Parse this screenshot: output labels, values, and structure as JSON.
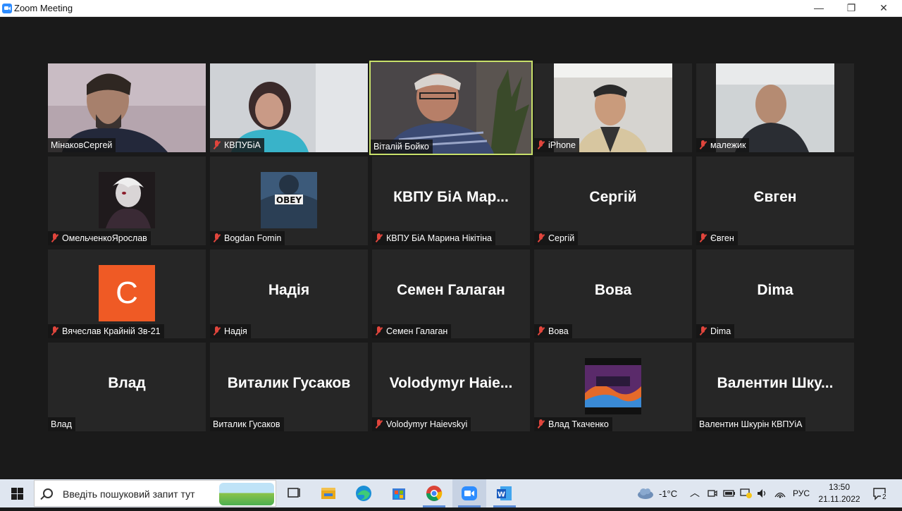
{
  "window": {
    "title": "Zoom Meeting",
    "minimize": "—",
    "maximize": "❐",
    "close": "✕"
  },
  "participants": [
    {
      "label": "МінаковСергей",
      "muted": false,
      "kind": "video"
    },
    {
      "label": "КВПУБіА",
      "muted": true,
      "kind": "video"
    },
    {
      "label": "Віталій Бойко",
      "muted": false,
      "kind": "video",
      "active": true
    },
    {
      "label": "iPhone",
      "muted": true,
      "kind": "video"
    },
    {
      "label": "малежик",
      "muted": true,
      "kind": "video"
    },
    {
      "label": "ОмельченкоЯрослав",
      "muted": true,
      "kind": "picture"
    },
    {
      "label": "Bogdan Fomin",
      "muted": true,
      "kind": "picture"
    },
    {
      "label": "КВПУ БіА Марина Нікітіна",
      "display": "КВПУ БіА Мар...",
      "muted": true,
      "kind": "name"
    },
    {
      "label": "Сергій",
      "display": "Сергій",
      "muted": true,
      "kind": "name"
    },
    {
      "label": "Євген",
      "display": "Євген",
      "muted": true,
      "kind": "name"
    },
    {
      "label": "Вячеслав Крайній Зв-21",
      "letter": "С",
      "muted": true,
      "kind": "letter"
    },
    {
      "label": "Надія",
      "display": "Надія",
      "muted": true,
      "kind": "name"
    },
    {
      "label": "Семен Галаган",
      "display": "Семен Галаган",
      "muted": true,
      "kind": "name"
    },
    {
      "label": "Вова",
      "display": "Вова",
      "muted": true,
      "kind": "name"
    },
    {
      "label": "Dima",
      "display": "Dima",
      "muted": true,
      "kind": "name"
    },
    {
      "label": "Влад",
      "display": "Влад",
      "muted": false,
      "kind": "name"
    },
    {
      "label": "Виталик Гусаков",
      "display": "Виталик Гусаков",
      "muted": false,
      "kind": "name"
    },
    {
      "label": "Volodymyr Haievskyi",
      "display": "Volodymyr Haie...",
      "muted": true,
      "kind": "name"
    },
    {
      "label": "Влад Ткаченко",
      "muted": true,
      "kind": "picture"
    },
    {
      "label": "Валентин Шкурін КВПУіА",
      "display": "Валентин Шку...",
      "muted": false,
      "kind": "name"
    }
  ],
  "taskbar": {
    "search_placeholder": "Введіть пошуковий запит тут",
    "weather": "-1°C",
    "language": "РУС",
    "time": "13:50",
    "date": "21.11.2022",
    "notifications": "2"
  },
  "colors": {
    "active_speaker": "#c8e06a",
    "muted_mic": "#e0453c",
    "avatar_bg": "#ef5a25"
  }
}
